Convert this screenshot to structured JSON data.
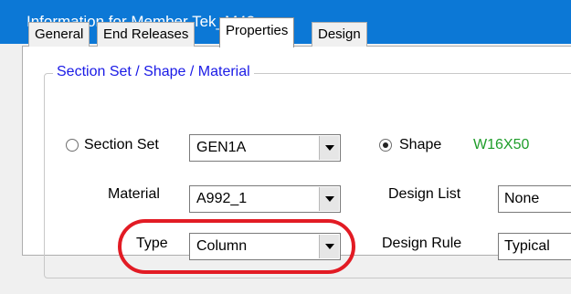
{
  "window": {
    "title": "Information for Member Tek_M42"
  },
  "tabs": [
    {
      "label": "General",
      "active": false
    },
    {
      "label": "End Releases",
      "active": false
    },
    {
      "label": "Properties",
      "active": true
    },
    {
      "label": "Design",
      "active": false
    }
  ],
  "group": {
    "title": "Section Set / Shape / Material",
    "section_set": {
      "radio_label": "Section Set",
      "value": "GEN1A",
      "selected": false
    },
    "shape": {
      "radio_label": "Shape",
      "value": "W16X50",
      "selected": true,
      "value_color": "#1f9d2a"
    },
    "material": {
      "label": "Material",
      "value": "A992_1"
    },
    "design_list": {
      "label": "Design List",
      "value": "None"
    },
    "type": {
      "label": "Type",
      "value": "Column"
    },
    "design_rule": {
      "label": "Design Rule",
      "value": "Typical"
    }
  },
  "annotation": {
    "highlight_color": "#e21b24"
  }
}
